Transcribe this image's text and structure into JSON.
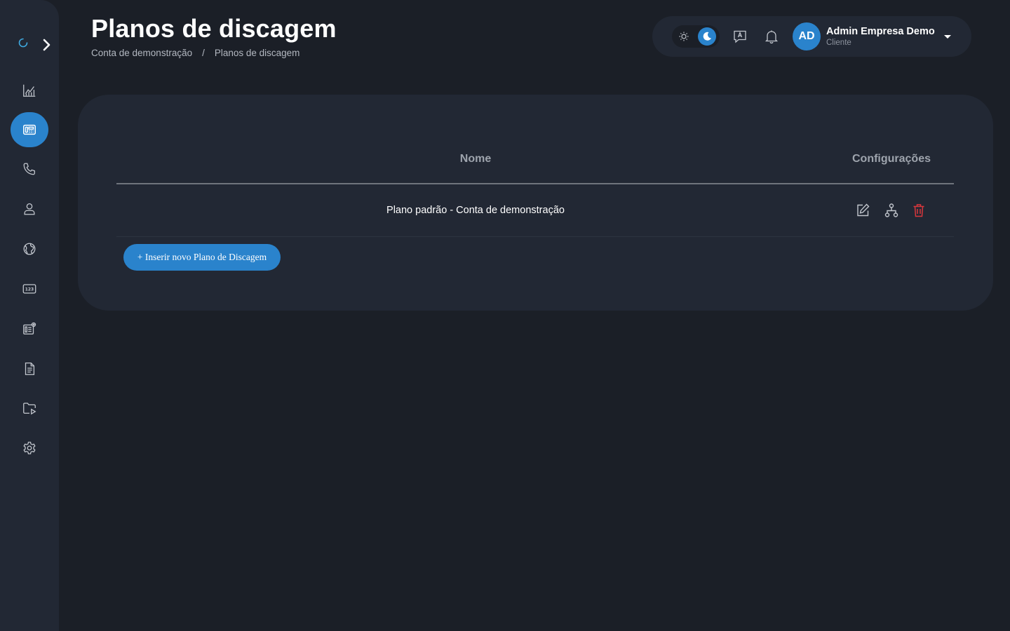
{
  "page": {
    "title": "Planos de discagem",
    "breadcrumb": [
      "Conta de demonstração",
      "/",
      "Planos de discagem"
    ]
  },
  "sidebar": {
    "items": [
      {
        "icon": "chart-icon",
        "active": false
      },
      {
        "icon": "dial-plan-icon",
        "active": true
      },
      {
        "icon": "phone-icon",
        "active": false
      },
      {
        "icon": "user-icon",
        "active": false
      },
      {
        "icon": "globe-icon",
        "active": false
      },
      {
        "icon": "numbers-icon",
        "active": false
      },
      {
        "icon": "routing-icon",
        "active": false
      },
      {
        "icon": "document-icon",
        "active": false
      },
      {
        "icon": "media-folder-icon",
        "active": false
      },
      {
        "icon": "settings-icon",
        "active": false
      }
    ]
  },
  "topbar": {
    "theme": "dark",
    "user": {
      "initials": "AD",
      "name": "Admin Empresa Demo",
      "role": "Cliente"
    }
  },
  "table": {
    "columns": [
      "Nome",
      "Configurações"
    ],
    "rows": [
      {
        "name": "Plano padrão - Conta de demonstração",
        "actions": [
          "edit-icon",
          "hierarchy-icon",
          "trash-icon"
        ]
      }
    ]
  },
  "actions": {
    "add_label": "+ Inserir novo Plano de Discagem"
  },
  "colors": {
    "accent": "#2a83cc",
    "danger": "#d9373c",
    "background": "#1b1f27",
    "surface": "#222834"
  }
}
